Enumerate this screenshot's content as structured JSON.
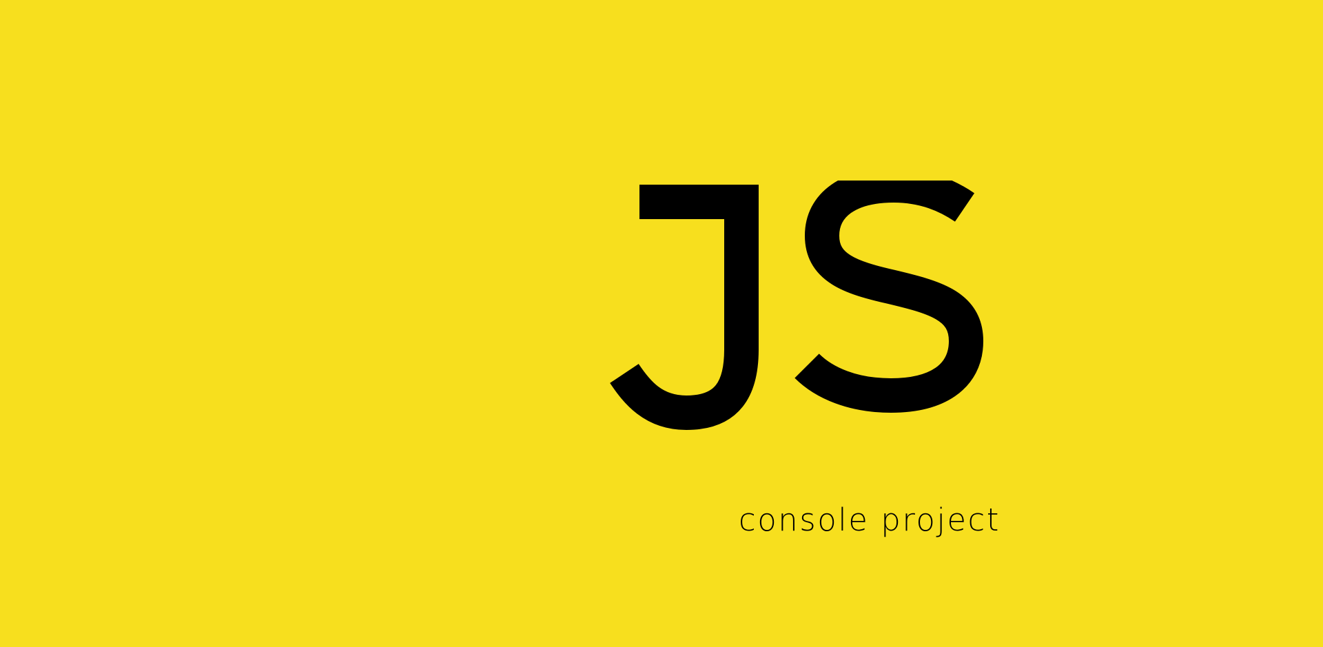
{
  "colors": {
    "background": "#F7DF1E",
    "foreground": "#000000"
  },
  "logo": {
    "text": "JS",
    "icon": "javascript-logo-icon"
  },
  "subtitle": {
    "text": "console project"
  }
}
